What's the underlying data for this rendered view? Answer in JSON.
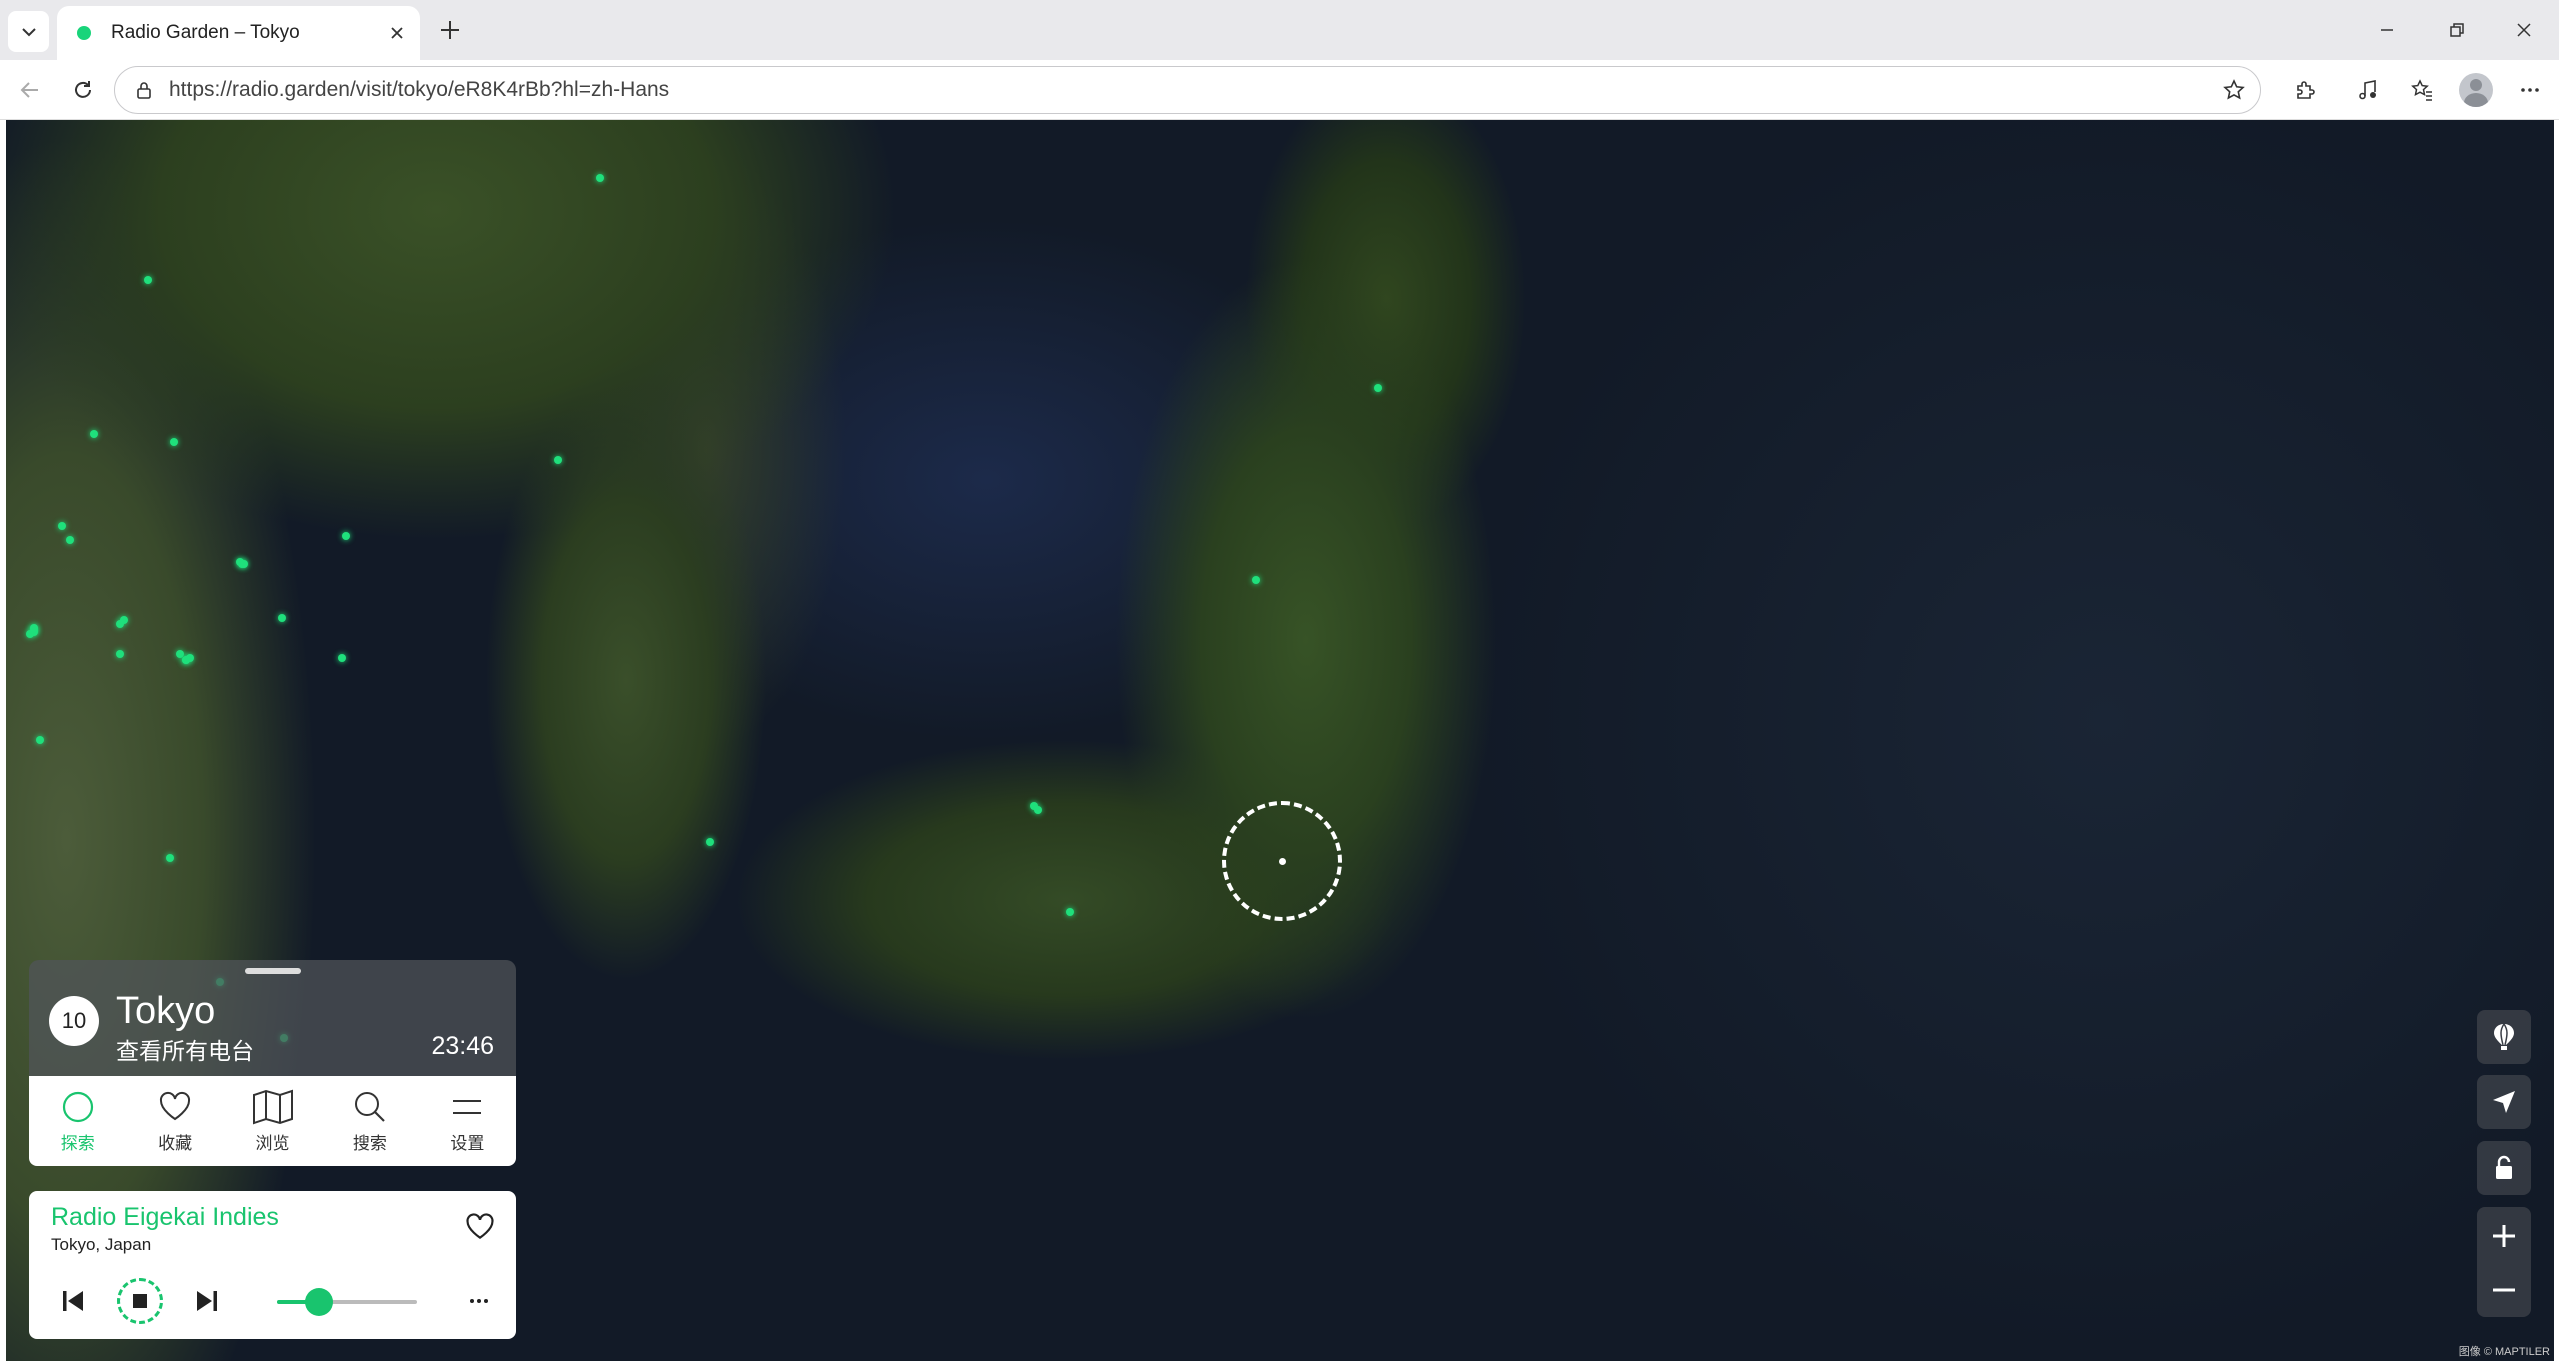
{
  "browser": {
    "tab_title": "Radio Garden – Tokyo",
    "url": "https://radio.garden/visit/tokyo/eR8K4rBb?hl=zh-Hans"
  },
  "city": {
    "station_count": "10",
    "name": "Tokyo",
    "view_all": "查看所有电台",
    "time": "23:46"
  },
  "nav": {
    "explore": "探索",
    "favorites": "收藏",
    "browse": "浏览",
    "search": "搜索",
    "settings": "设置"
  },
  "player": {
    "station_name": "Radio Eigekai Indies",
    "location": "Tokyo, Japan",
    "volume": 0.3
  },
  "map": {
    "credit": "图像 © MAPTILER"
  },
  "colors": {
    "accent": "#19c46e",
    "station_dot": "#1fe07c",
    "panel_dark": "#50545a"
  }
}
